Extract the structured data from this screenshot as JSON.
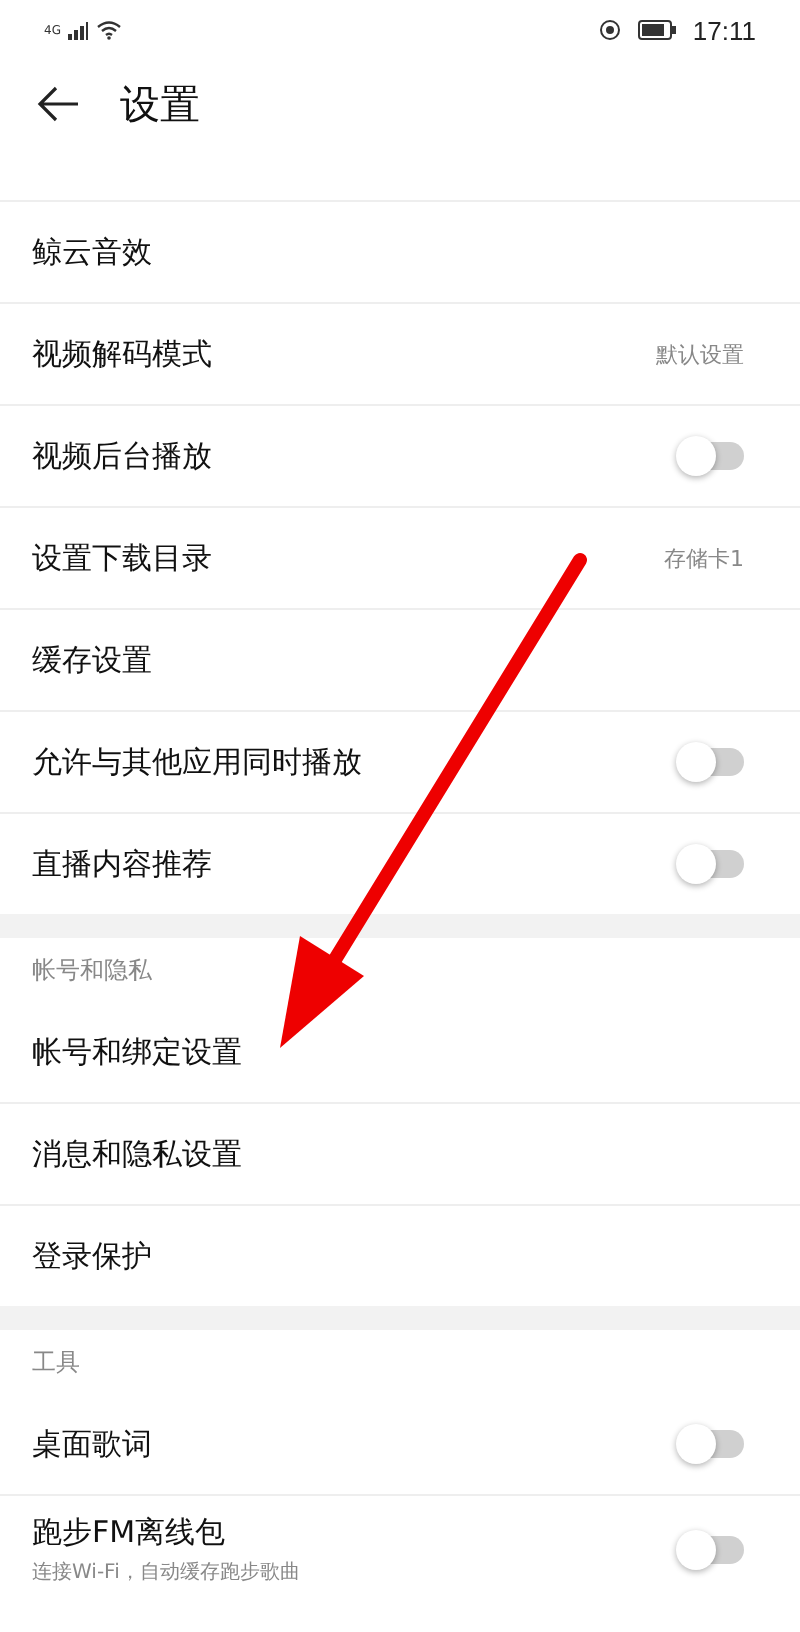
{
  "status_bar": {
    "network": "4G",
    "time": "17:11"
  },
  "header": {
    "title": "设置"
  },
  "sections": [
    {
      "items": [
        {
          "kind": "link",
          "label": "鲸云音效"
        },
        {
          "kind": "value",
          "label": "视频解码模式",
          "value": "默认设置"
        },
        {
          "kind": "toggle",
          "label": "视频后台播放",
          "on": false
        },
        {
          "kind": "value",
          "label": "设置下载目录",
          "value": "存储卡1"
        },
        {
          "kind": "link",
          "label": "缓存设置"
        },
        {
          "kind": "toggle",
          "label": "允许与其他应用同时播放",
          "on": false
        },
        {
          "kind": "toggle",
          "label": "直播内容推荐",
          "on": false
        }
      ]
    },
    {
      "title": "帐号和隐私",
      "items": [
        {
          "kind": "link",
          "label": "帐号和绑定设置"
        },
        {
          "kind": "link",
          "label": "消息和隐私设置"
        },
        {
          "kind": "link",
          "label": "登录保护"
        }
      ]
    },
    {
      "title": "工具",
      "items": [
        {
          "kind": "toggle",
          "label": "桌面歌词",
          "on": false
        },
        {
          "kind": "toggle",
          "label": "跑步FM离线包",
          "subtitle": "连接Wi-Fi，自动缓存跑步歌曲",
          "on": false
        }
      ]
    }
  ]
}
